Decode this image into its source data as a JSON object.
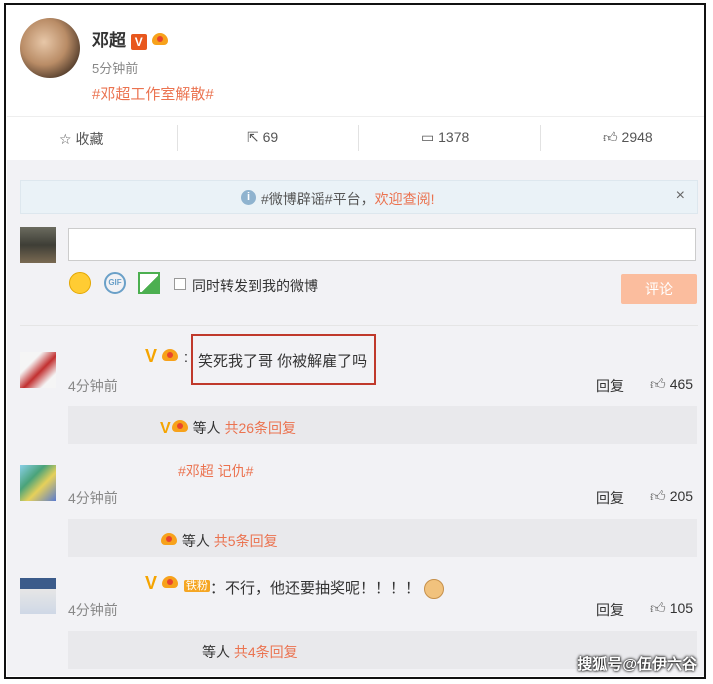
{
  "post": {
    "author": "邓超",
    "time": "5分钟前",
    "topic": "#邓超工作室解散#",
    "verified_badge": "V"
  },
  "actions": {
    "favorite_label": "收藏",
    "repost_count": "69",
    "comment_count": "1378",
    "like_count": "2948"
  },
  "notice": {
    "text": "#微博辟谣#平台，",
    "link": "欢迎查阅!",
    "close": "×"
  },
  "composer": {
    "input_value": "",
    "repost_label": "同时转发到我的微博",
    "submit_label": "评论",
    "gif_label": "GIF"
  },
  "comments": [
    {
      "text": "笑死我了哥 你被解雇了吗",
      "time": "4分钟前",
      "reply_label": "回复",
      "likes": "465",
      "sub_prefix": "等人",
      "sub_link": "共26条回复"
    },
    {
      "text": "#邓超 记仇#",
      "time": "4分钟前",
      "reply_label": "回复",
      "likes": "205",
      "sub_prefix": "等人",
      "sub_link": "共5条回复"
    },
    {
      "text": "不行，他还要抽奖呢！！！！",
      "time": "4分钟前",
      "reply_label": "回复",
      "likes": "105",
      "sub_prefix": "等人",
      "sub_link": "共4条回复",
      "vip_tag": "铁粉"
    }
  ],
  "watermark": "搜狐号@伍伊六谷",
  "colors": {
    "accent": "#eb7350",
    "submit_bg": "#fbbd9e",
    "highlight_border": "#c0392b"
  }
}
